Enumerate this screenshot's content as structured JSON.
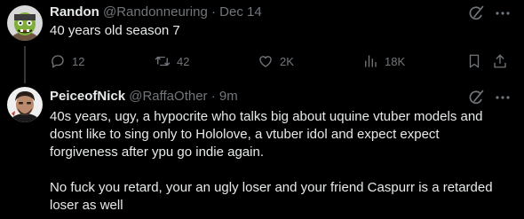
{
  "tweets": [
    {
      "display_name": "Randon",
      "handle": "@Randonneuring",
      "separator": "·",
      "time": "Dec 14",
      "text": "40 years old season 7",
      "actions": {
        "reply_count": "12",
        "retweet_count": "42",
        "like_count": "2K",
        "view_count": "18K"
      }
    },
    {
      "display_name": "PeiceofNick",
      "handle": "@RaffaOther",
      "separator": "·",
      "time": "9m",
      "text": "40s years, ugy, a hypocrite who talks big about uquine vtuber models and dosnt like to sing only to Hololove, a vtuber idol and expect expect forgiveness after ypu go indie again.\n\nNo fuck you retard, your an ugly loser and your friend Caspurr is a retarded loser as well"
    }
  ],
  "icons": {
    "grok": "grok-icon",
    "more": "more-icon",
    "reply": "reply-icon",
    "retweet": "retweet-icon",
    "like": "heart-icon",
    "views": "views-icon",
    "bookmark": "bookmark-icon",
    "share": "share-icon"
  },
  "colors": {
    "background": "#000000",
    "primary_text": "#e7e9ea",
    "secondary_text": "#71767b",
    "thread_line": "#333639"
  }
}
